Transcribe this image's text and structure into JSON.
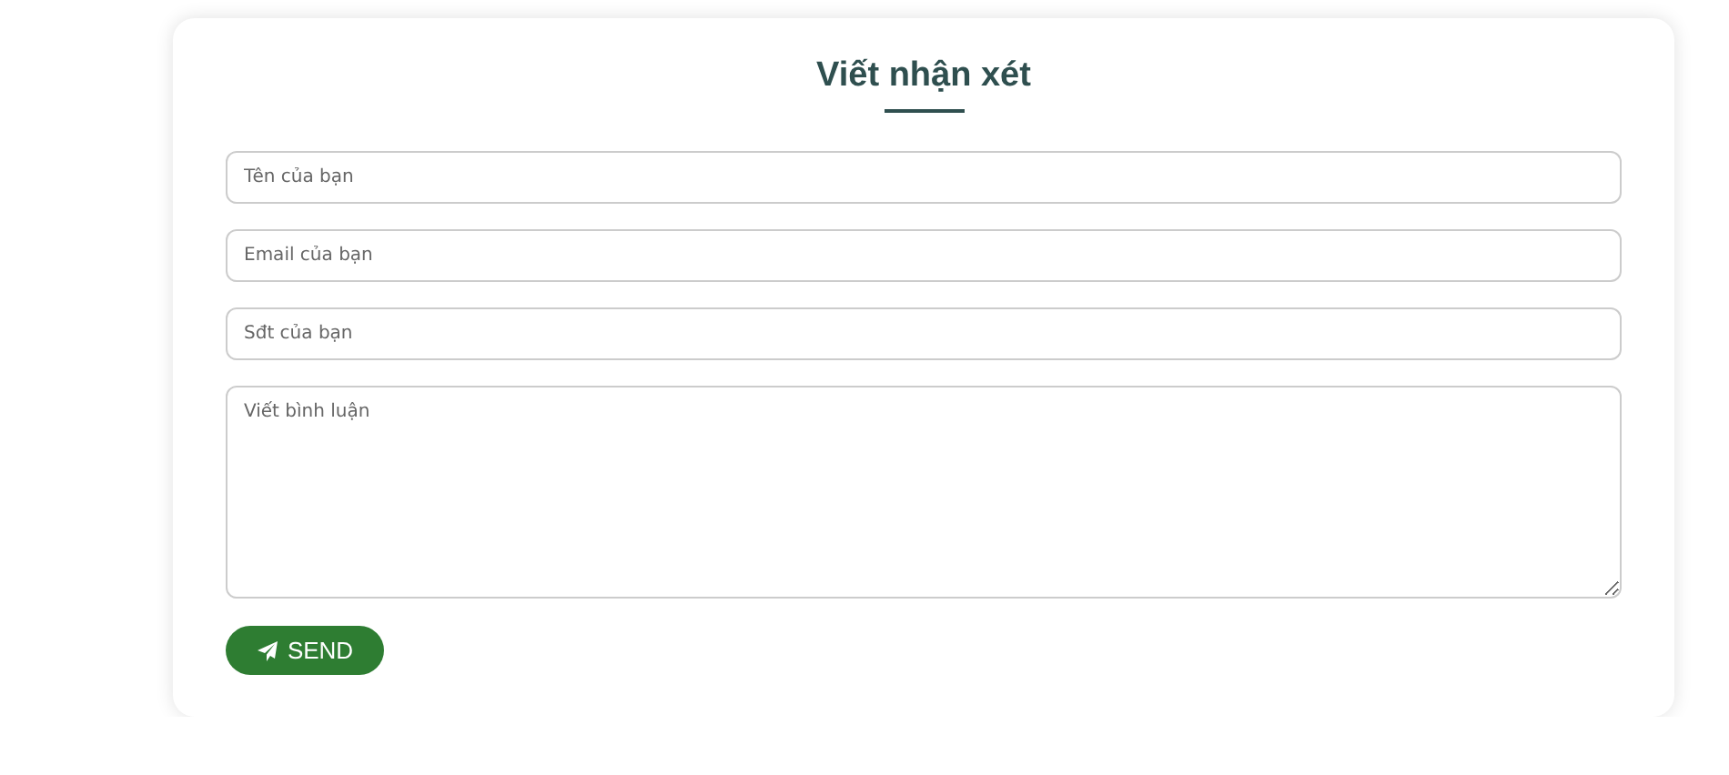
{
  "title": "Viết nhận xét",
  "fields": [
    {
      "kind": "input",
      "placeholder": "Tên của bạn"
    },
    {
      "kind": "input",
      "placeholder": "Email của bạn"
    },
    {
      "kind": "input",
      "placeholder": "Sđt của bạn"
    },
    {
      "kind": "textarea",
      "placeholder": "Viết bình luận"
    }
  ],
  "button": {
    "label": "SEND"
  }
}
